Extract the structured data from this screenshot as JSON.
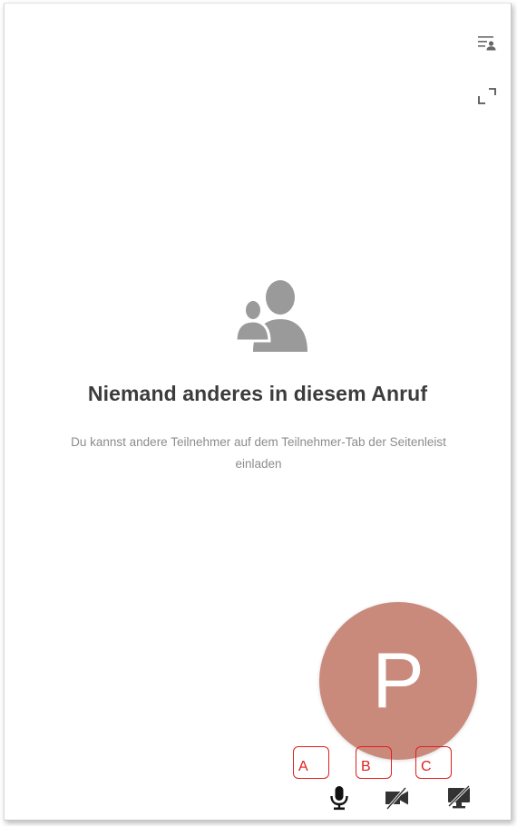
{
  "empty_state": {
    "title": "Niemand anderes in diesem Anruf",
    "subtitle_line1": "Du kannst andere Teilnehmer auf dem Teilnehmer-Tab der Seitenleist",
    "subtitle_line2": "einladen"
  },
  "avatar": {
    "initial": "P",
    "color": "#c98a7c"
  },
  "markers": {
    "a": "A",
    "b": "B",
    "c": "C"
  },
  "icons": {
    "participants": "participants-list-icon",
    "fullscreen": "fullscreen-icon",
    "empty": "users-icon",
    "mic": "microphone-icon",
    "video": "video-off-icon",
    "screen": "screen-share-off-icon"
  },
  "colors": {
    "icon_gray": "#9a9a9a",
    "marker_red": "#e02020",
    "control_dark": "#222222"
  }
}
